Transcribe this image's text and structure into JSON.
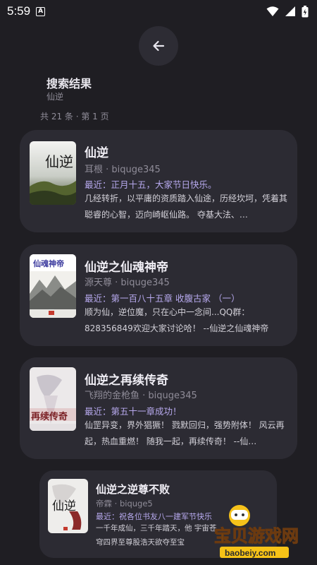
{
  "status_bar": {
    "time": "5:59",
    "indicator": "A"
  },
  "header": {
    "title": "搜索结果",
    "query": "仙逆",
    "page_info": "共 21 条 · 第 1 页"
  },
  "results": [
    {
      "title": "仙逆",
      "author_source": "耳根 · biquge345",
      "latest": "最近：正月十五，大家节日快乐。",
      "description": "几经转折，以平庸的资质踏入仙途，历经坎坷，凭着其聪睿的心智，迈向崎岖仙路。 夺基大法、…",
      "cover_text": "仙逆"
    },
    {
      "title": "仙逆之仙魂神帝",
      "author_source": "源天尊 · biquge345",
      "latest": "最近：第一百八十五章 收腹古家 （一）",
      "description": "顺为仙，逆位魔，只在心中一念间...QQ群：828356849欢迎大家讨论哈！ --仙逆之仙魂神帝",
      "cover_text": "仙魂神帝"
    },
    {
      "title": "仙逆之再续传奇",
      "author_source": "飞翔的金枪鱼 · biquge345",
      "latest": "最近：第五十一章成功！",
      "description": "仙罡异变，界外猖獗！ 戮默回归，强势附体！ 风云再起，热血重燃！ 随我一起，再续传奇！ --仙…",
      "cover_text": "再续传奇"
    },
    {
      "title": "仙逆之逆尊不败",
      "author_source": "帝霖 · biquge5",
      "latest": "最近：祝各位书友八一建军节快乐",
      "description": "一千年成仙，三千年踏天，他 宇宙苍穹四界至尊股浩天欲夺至宝",
      "cover_text": "仙逆"
    }
  ],
  "watermark": {
    "text": "宝贝游戏网",
    "url": "baobeiy.com"
  },
  "colors": {
    "background": "#1f1e23",
    "card": "#2c2b33",
    "accent": "#b7a9ee"
  }
}
